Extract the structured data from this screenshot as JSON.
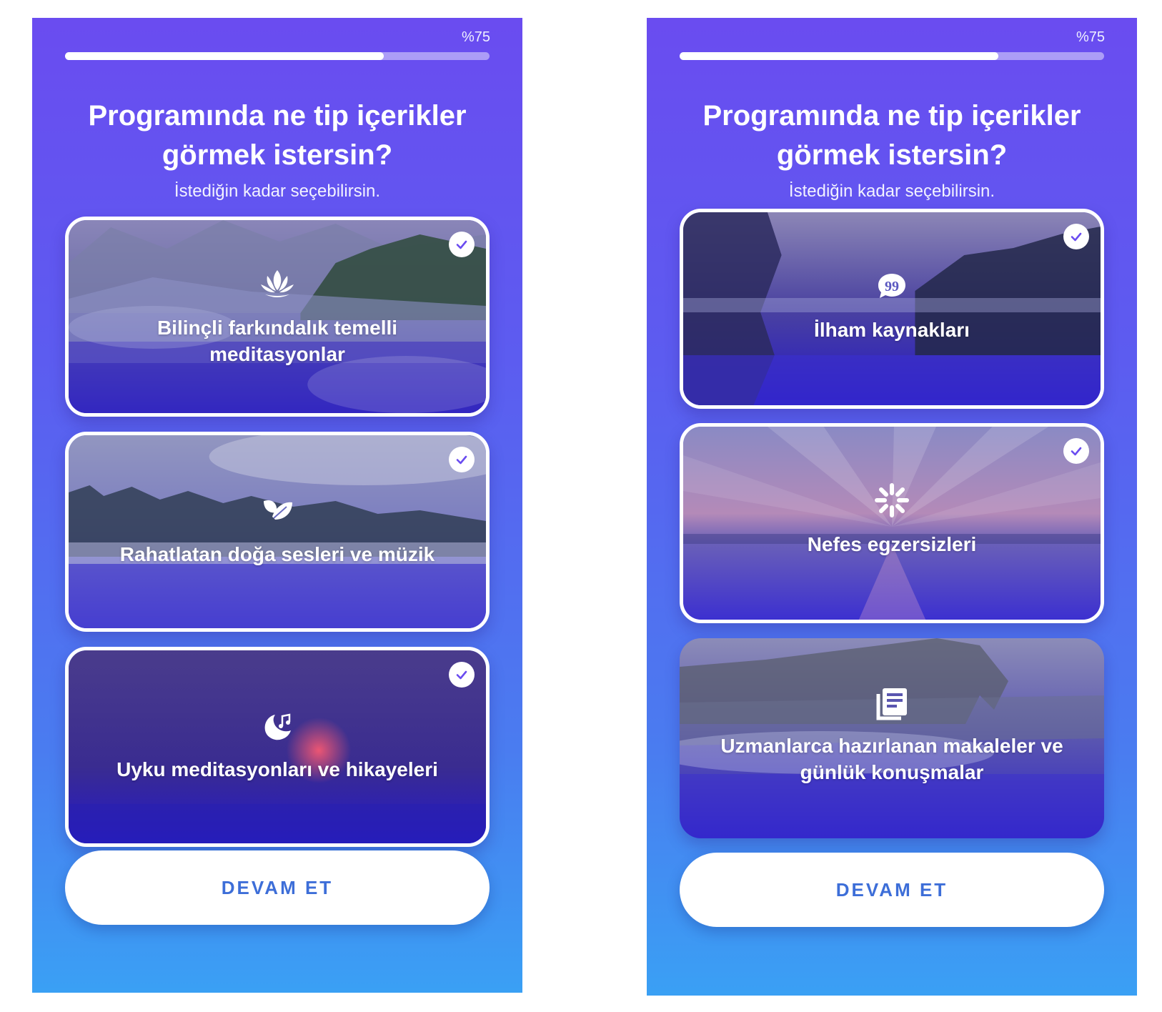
{
  "colors": {
    "gradient_top": "#6a4cf0",
    "gradient_bottom": "#3aa0f4",
    "cta_text": "#3d6ed8",
    "check_color": "#6a4cf0"
  },
  "screens": [
    {
      "progress": {
        "label": "%75",
        "value": 0.75
      },
      "title": "Programında ne tip içerikler görmek istersin?",
      "subtitle": "İstediğin kadar seçebilirsin.",
      "options": [
        {
          "label": "Bilinçli farkındalık temelli meditasyonlar",
          "icon": "lotus-icon",
          "selected": true
        },
        {
          "label": "Rahatlatan doğa sesleri ve müzik",
          "icon": "leaves-icon",
          "selected": true
        },
        {
          "label": "Uyku meditasyonları ve hikayeleri",
          "icon": "moon-music-icon",
          "selected": true
        }
      ],
      "cta_label": "DEVAM ET"
    },
    {
      "progress": {
        "label": "%75",
        "value": 0.75
      },
      "title": "Programında ne tip içerikler görmek istersin?",
      "subtitle": "İstediğin kadar seçebilirsin.",
      "options": [
        {
          "label": "İlham kaynakları",
          "icon": "quote-bubble-icon",
          "selected": true
        },
        {
          "label": "Nefes egzersizleri",
          "icon": "breath-burst-icon",
          "selected": true
        },
        {
          "label": "Uzmanlarca hazırlanan makaleler ve günlük konuşmalar",
          "icon": "articles-icon",
          "selected": false
        }
      ],
      "cta_label": "DEVAM ET"
    }
  ]
}
